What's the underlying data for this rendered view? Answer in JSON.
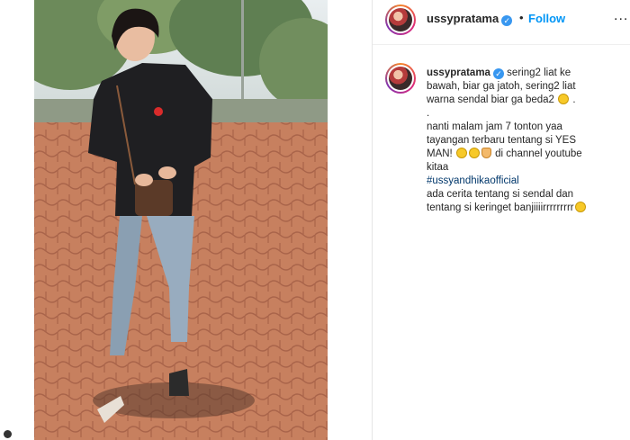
{
  "header": {
    "username": "ussypratama",
    "separator": "•",
    "follow_label": "Follow",
    "more_label": "..."
  },
  "caption": {
    "username": "ussypratama",
    "lines": [
      "sering2 liat ke",
      "bawah, biar ga jatoh, sering2 liat",
      "warna sendal biar ga beda2",
      ".",
      "nanti malam jam 7 tonton yaa",
      "tayangan terbaru tentang si YES",
      "MAN!",
      "di channel youtube",
      "kitaa",
      "#ussyandhikaofficial",
      "ada cerita tentang si sendal dan",
      "tentang si keringet banjiiiirrrrrrrrr"
    ]
  },
  "colors": {
    "follow": "#0095f6",
    "verified": "#3897f0",
    "hashtag": "#00376b"
  },
  "icons": [
    "verified-badge-icon",
    "grin-emoji-icon",
    "pray-emoji-icon",
    "more-options-icon"
  ]
}
